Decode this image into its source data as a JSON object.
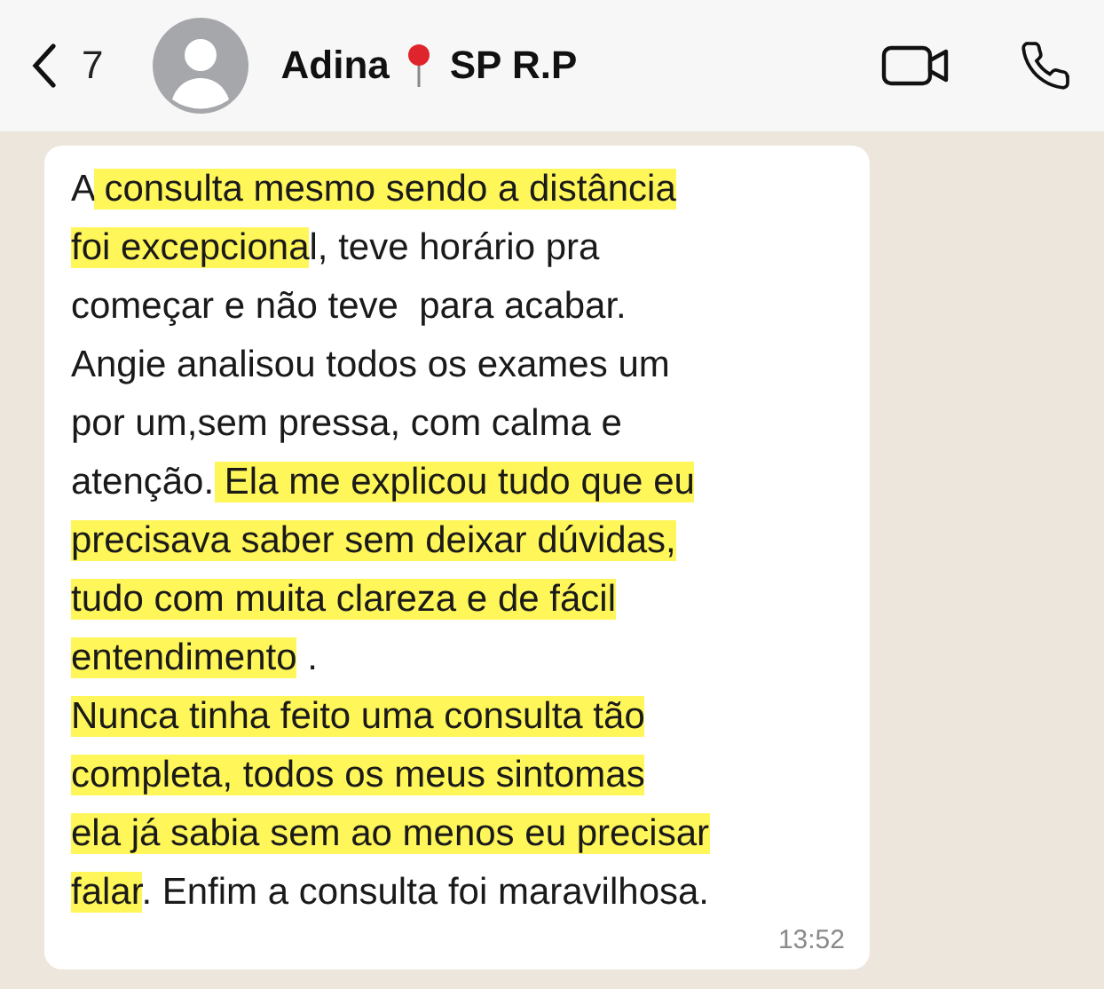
{
  "header": {
    "back_count": "7",
    "name": "Adina",
    "location": "SP R.P"
  },
  "message": {
    "time": "13:52",
    "lines": [
      {
        "segments": [
          {
            "text": "A",
            "highlighted": false
          },
          {
            "text": " consulta mesmo sendo a distância",
            "highlighted": true
          }
        ]
      },
      {
        "segments": [
          {
            "text": "foi excepciona",
            "highlighted": true
          },
          {
            "text": "l, teve horário pra",
            "highlighted": false
          }
        ]
      },
      {
        "segments": [
          {
            "text": "começar e não teve  para acabar.",
            "highlighted": false
          }
        ]
      },
      {
        "segments": [
          {
            "text": "Angie analisou todos os exames um",
            "highlighted": false
          }
        ]
      },
      {
        "segments": [
          {
            "text": "por um,sem pressa, com calma e",
            "highlighted": false
          }
        ]
      },
      {
        "segments": [
          {
            "text": "atenção.",
            "highlighted": false
          },
          {
            "text": " Ela me explicou tudo que eu",
            "highlighted": true
          }
        ]
      },
      {
        "segments": [
          {
            "text": "precisava saber sem deixar dúvidas,",
            "highlighted": true
          }
        ]
      },
      {
        "segments": [
          {
            "text": "tudo com muita clareza e de fácil",
            "highlighted": true
          }
        ]
      },
      {
        "segments": [
          {
            "text": "entendimento",
            "highlighted": true
          },
          {
            "text": " .",
            "highlighted": false
          }
        ]
      },
      {
        "segments": [
          {
            "text": "Nunca tinha feito uma consulta tão",
            "highlighted": true
          }
        ]
      },
      {
        "segments": [
          {
            "text": "completa, todos os meus sintomas",
            "highlighted": true
          }
        ]
      },
      {
        "segments": [
          {
            "text": "ela já sabia sem ao menos eu precisar",
            "highlighted": true
          }
        ]
      },
      {
        "segments": [
          {
            "text": "falar",
            "highlighted": true
          },
          {
            "text": ". Enfim a consulta foi maravilhosa.",
            "highlighted": false
          }
        ]
      }
    ]
  }
}
